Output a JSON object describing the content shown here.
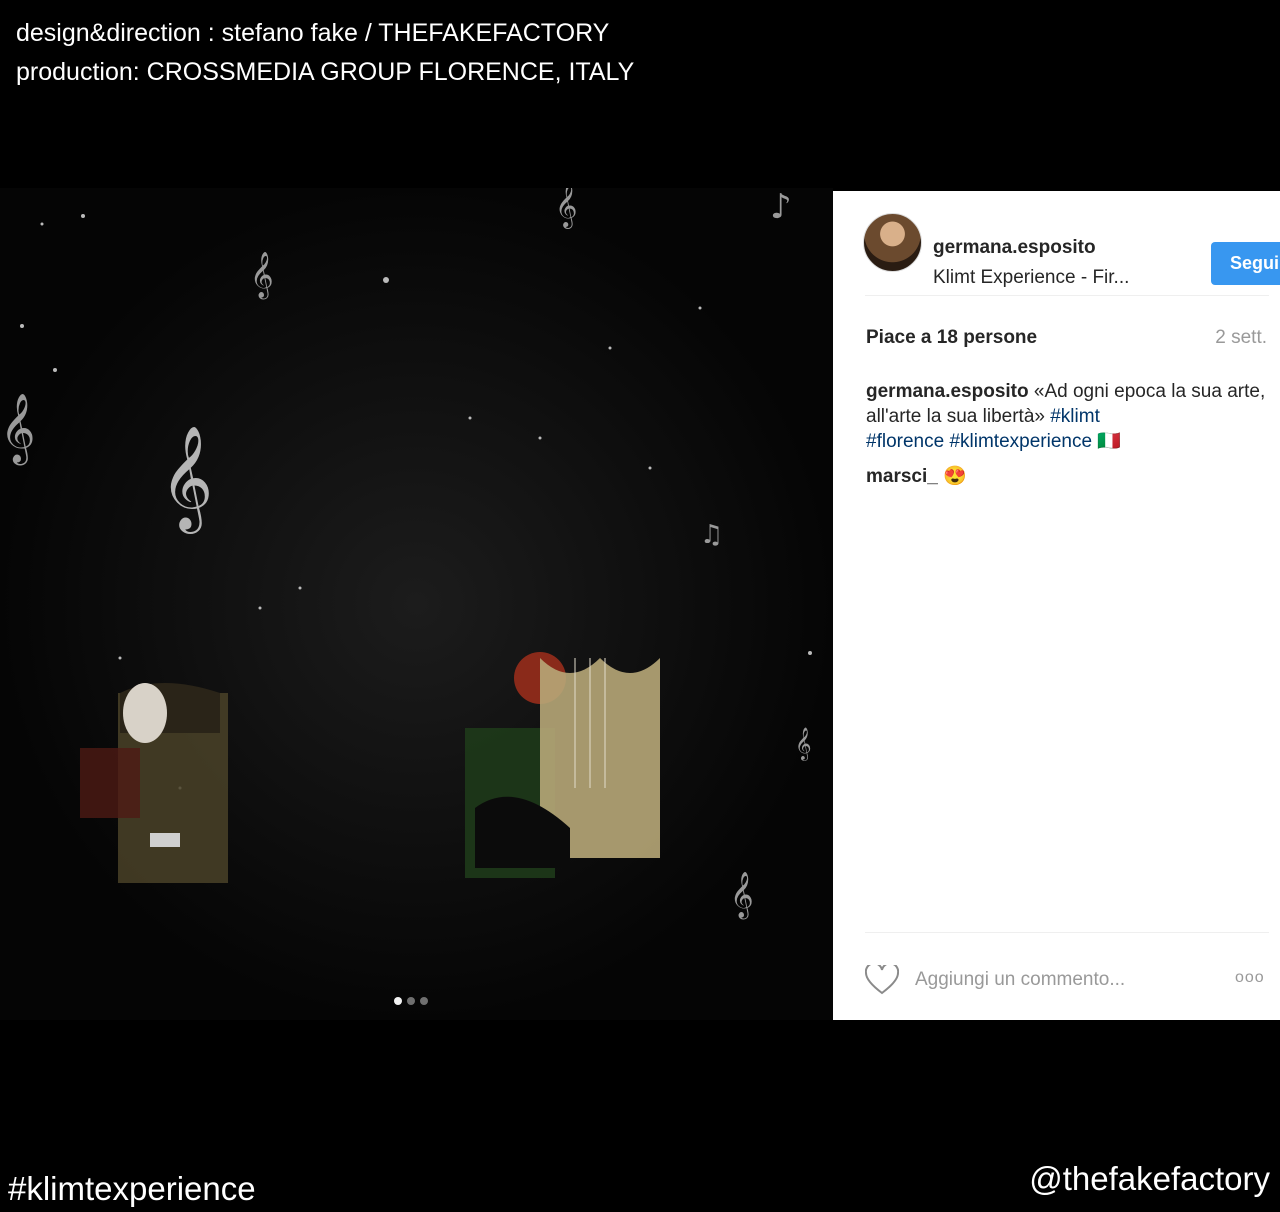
{
  "credits": {
    "line1": "design&direction : stefano fake / THEFAKEFACTORY",
    "line2": "production: CROSSMEDIA GROUP FLORENCE, ITALY"
  },
  "post": {
    "username": "germana.esposito",
    "location": "Klimt Experience - Fir...",
    "follow_label": "Segui",
    "likes": "Piace a 18 persone",
    "time": "2 sett.",
    "caption_user": "germana.esposito",
    "caption_text": " «Ad ogni epoca la sua arte, all'arte la sua libertà» ",
    "tags": [
      "#klimt",
      "#florence",
      "#klimtexperience"
    ],
    "caption_trailing_glyph": "🇮🇹",
    "comment_user": "marsci_",
    "comment_text": "😍",
    "comment_placeholder": "Aggiungi un commento...",
    "more_label": "ooo"
  },
  "carousel": {
    "count": 3,
    "active": 1
  },
  "footer": {
    "hashtag": "#klimtexperience",
    "handle": "@thefakefactory"
  },
  "colors": {
    "follow_button": "#3897f0",
    "hashtag_link": "#003569",
    "background": "#000000"
  },
  "icons": [
    "heart-icon",
    "more-icon",
    "avatar"
  ]
}
